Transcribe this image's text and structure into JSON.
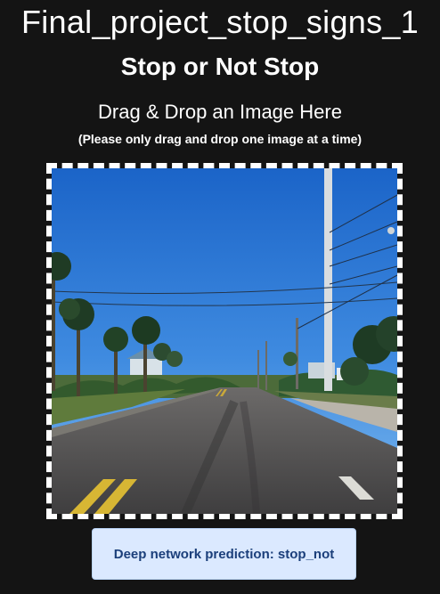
{
  "header": {
    "project_title": "Final_project_stop_signs_1",
    "app_title": "Stop or Not Stop"
  },
  "dropzone": {
    "heading": "Drag & Drop an Image Here",
    "note": "(Please only drag and drop one image at a time)"
  },
  "prediction": {
    "text": "Deep network prediction: stop_not"
  }
}
